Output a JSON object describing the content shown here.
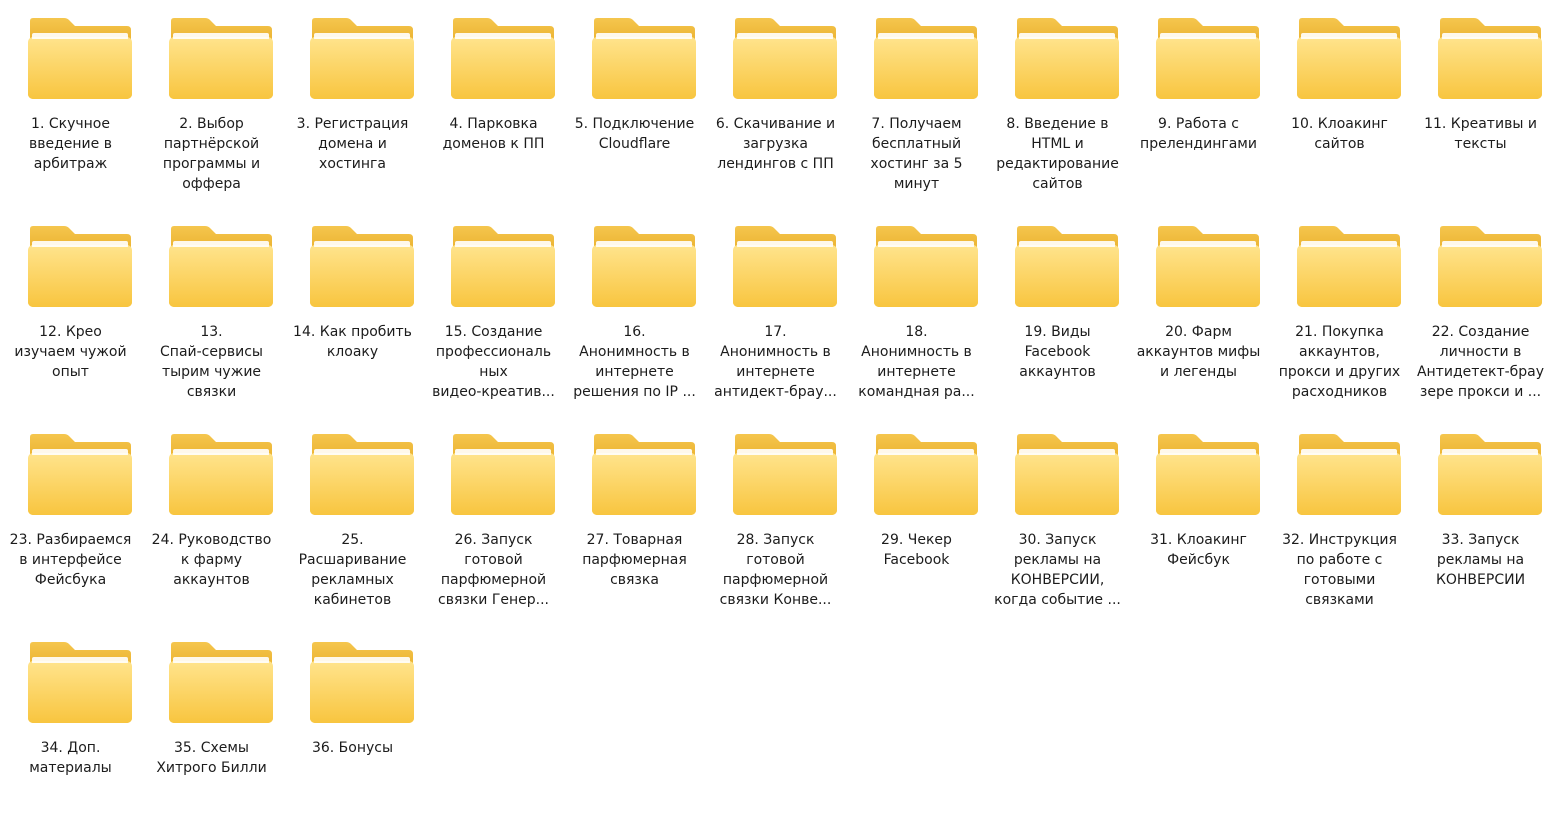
{
  "folders": [
    {
      "name": "1. Скучное\nвведение в\nарбитраж"
    },
    {
      "name": "2. Выбор\nпартнёрской\nпрограммы и\nоффера"
    },
    {
      "name": "3. Регистрация\nдомена и\nхостинга"
    },
    {
      "name": "4. Парковка\nдоменов к ПП"
    },
    {
      "name": "5. Подключение\nCloudflare"
    },
    {
      "name": "6. Скачивание и\nзагрузка\nлендингов с ПП"
    },
    {
      "name": "7. Получаем\nбесплатный\nхостинг за 5\nминут"
    },
    {
      "name": "8. Введение в\nHTML и\nредактирование\nсайтов"
    },
    {
      "name": "9. Работа с\nпрелендингами"
    },
    {
      "name": "10. Клоакинг\nсайтов"
    },
    {
      "name": "11. Креативы и\nтексты"
    },
    {
      "name": "12. Крео\nизучаем чужой\nопыт"
    },
    {
      "name": "13.\nСпай-сервисы\nтырим чужие\nсвязки"
    },
    {
      "name": "14. Как пробить\nклоаку"
    },
    {
      "name": "15. Создание\nпрофессиональ\nных\nвидео-креатив..."
    },
    {
      "name": "16.\nАнонимность в\nинтернете\nрешения по IP ..."
    },
    {
      "name": "17.\nАнонимность в\nинтернете\nантидект-брау..."
    },
    {
      "name": "18.\nАнонимность в\nинтернете\nкомандная ра..."
    },
    {
      "name": "19. Виды\nFacebook\nаккаунтов"
    },
    {
      "name": "20. Фарм\nаккаунтов мифы\nи легенды"
    },
    {
      "name": "21. Покупка\nаккаунтов,\nпрокси и других\nрасходников"
    },
    {
      "name": "22. Создание\nличности в\nАнтидетект-брау\nзере прокси и ..."
    },
    {
      "name": "23. Разбираемся\nв интерфейсе\nФейсбука"
    },
    {
      "name": "24. Руководство\nк фарму\nаккаунтов"
    },
    {
      "name": "25.\nРасшаривание\nрекламных\nкабинетов"
    },
    {
      "name": "26. Запуск\nготовой\nпарфюмерной\nсвязки Генер..."
    },
    {
      "name": "27. Товарная\nпарфюмерная\nсвязка"
    },
    {
      "name": "28. Запуск\nготовой\nпарфюмерной\nсвязки Конве..."
    },
    {
      "name": "29. Чекер\nFacebook"
    },
    {
      "name": "30. Запуск\nрекламы на\nКОНВЕРСИИ,\nкогда событие ..."
    },
    {
      "name": "31. Клоакинг\nФейсбук"
    },
    {
      "name": "32. Инструкция\nпо работе с\nготовыми\nсвязками"
    },
    {
      "name": "33. Запуск\nрекламы на\nКОНВЕРСИИ"
    },
    {
      "name": "34. Доп.\nматериалы"
    },
    {
      "name": "35. Схемы\nХитрого Билли"
    },
    {
      "name": "36. Бонусы"
    }
  ],
  "icon": "folder-icon",
  "colors": {
    "folder_back": "#F2C14E",
    "folder_front_top": "#FFE082",
    "folder_front_bottom": "#F9C842",
    "label_text": "#1c1c1c"
  }
}
